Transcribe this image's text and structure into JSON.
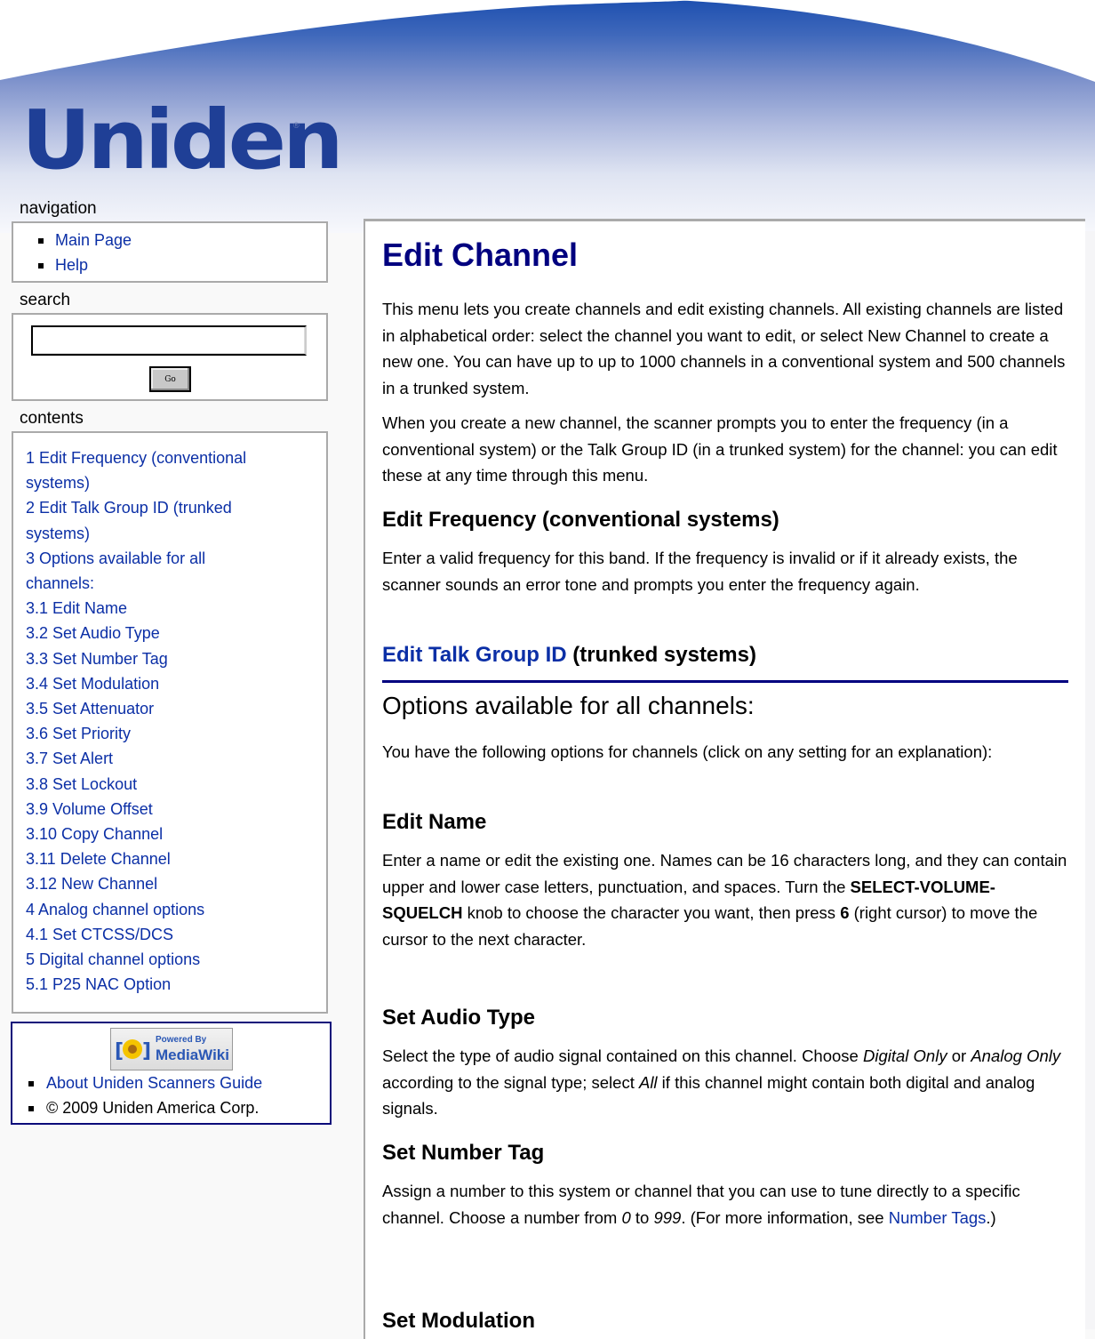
{
  "brand": {
    "logo_text": "Uniden",
    "registered_mark": "®",
    "colors": {
      "logo_blue": "#1f3f96",
      "link_blue": "#0b2fa6",
      "heading_navy": "#00007f",
      "border_gray": "#aaaaaa"
    }
  },
  "sidebar": {
    "navigation": {
      "title": "navigation",
      "items": [
        {
          "label": "Main Page"
        },
        {
          "label": "Help"
        }
      ]
    },
    "search": {
      "title": "search",
      "input_value": "",
      "go_label": "Go"
    },
    "contents": {
      "title": "contents",
      "items": [
        {
          "label": "1 Edit Frequency (conventional"
        },
        {
          "label": "systems)"
        },
        {
          "label": "2 Edit Talk Group ID (trunked"
        },
        {
          "label": "systems)"
        },
        {
          "label": "3 Options available for all"
        },
        {
          "label": "channels:"
        },
        {
          "label": "3.1 Edit Name"
        },
        {
          "label": "3.2 Set Audio Type"
        },
        {
          "label": "3.3 Set Number Tag"
        },
        {
          "label": "3.4 Set Modulation"
        },
        {
          "label": "3.5 Set Attenuator"
        },
        {
          "label": "3.6 Set Priority"
        },
        {
          "label": "3.7 Set Alert"
        },
        {
          "label": "3.8 Set Lockout"
        },
        {
          "label": "3.9 Volume Offset"
        },
        {
          "label": "3.10 Copy Channel"
        },
        {
          "label": "3.11 Delete Channel"
        },
        {
          "label": "3.12 New Channel"
        },
        {
          "label": "4 Analog channel options"
        },
        {
          "label": "4.1 Set CTCSS/DCS"
        },
        {
          "label": "5 Digital channel options"
        },
        {
          "label": "5.1 P25 NAC Option"
        }
      ]
    },
    "footer": {
      "badge_small": "Powered By",
      "badge_big": "MediaWiki",
      "about_link": "About Uniden Scanners Guide",
      "copyright": "© 2009 Uniden America Corp."
    }
  },
  "main": {
    "title": "Edit Channel",
    "intro_1": "This menu lets you create channels and edit existing channels. All existing channels are listed in alphabetical order: select the channel you want to edit, or select New Channel to create a new one. You can have up to up to 1000 channels in a conventional system and 500 channels in a trunked system.",
    "intro_2": "When you create a new channel, the scanner prompts you to enter the frequency (in a conventional system) or the Talk Group ID (in a trunked system) for the channel: you can edit these at any time through this menu.",
    "edit_frequency": {
      "heading": "Edit Frequency (conventional systems)",
      "body": "Enter a valid frequency for this band. If the frequency is invalid or if it already exists, the scanner sounds an error tone and prompts you enter the frequency again."
    },
    "edit_talk_group": {
      "heading_link": "Edit Talk Group ID",
      "heading_rest": " (trunked systems)"
    },
    "options": {
      "heading": "Options available for all channels:",
      "body": "You have the following options for channels (click on any setting for an explanation):"
    },
    "edit_name": {
      "heading": "Edit Name",
      "body_1": "Enter a name or edit the existing one. Names can be 16 characters long, and they can contain upper and lower case letters, punctuation, and spaces. Turn the ",
      "knob": "SELECT-VOLUME-SQUELCH",
      "body_2": " knob to choose the character you want, then press ",
      "key": "6",
      "body_3": " (right cursor) to move the cursor to the next character."
    },
    "set_audio_type": {
      "heading": "Set Audio Type",
      "body_1": "Select the type of audio signal contained on this channel. Choose ",
      "opt_digital": "Digital Only",
      "body_2": " or ",
      "opt_analog": "Analog Only",
      "body_3": " according to the signal type; select ",
      "opt_all": "All",
      "body_4": " if this channel might contain both digital and analog signals."
    },
    "set_number_tag": {
      "heading": "Set Number Tag",
      "body_1": "Assign a number to this system or channel that you can use to tune directly to a specific channel. Choose a number from ",
      "min": "0",
      "body_2": " to ",
      "max": "999",
      "body_3": ". (For more information, see ",
      "link": "Number Tags",
      "body_4": ".)"
    },
    "set_modulation": {
      "heading": "Set Modulation"
    }
  }
}
